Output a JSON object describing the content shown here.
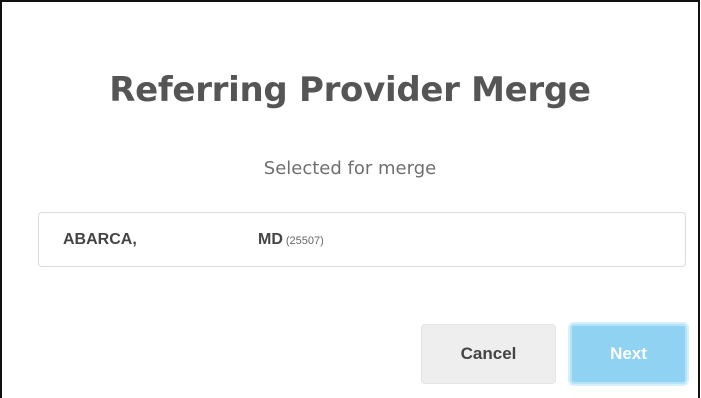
{
  "dialog": {
    "title": "Referring Provider Merge",
    "subtitle": "Selected for merge"
  },
  "selected_provider": {
    "last_name": "ABARCA,",
    "credential": "MD",
    "id": "(25507)"
  },
  "actions": {
    "cancel_label": "Cancel",
    "next_label": "Next",
    "next_enabled": false
  },
  "colors": {
    "title_text": "#555555",
    "next_button_bg": "#8fd2f2",
    "cancel_button_bg": "#eeeeee"
  }
}
